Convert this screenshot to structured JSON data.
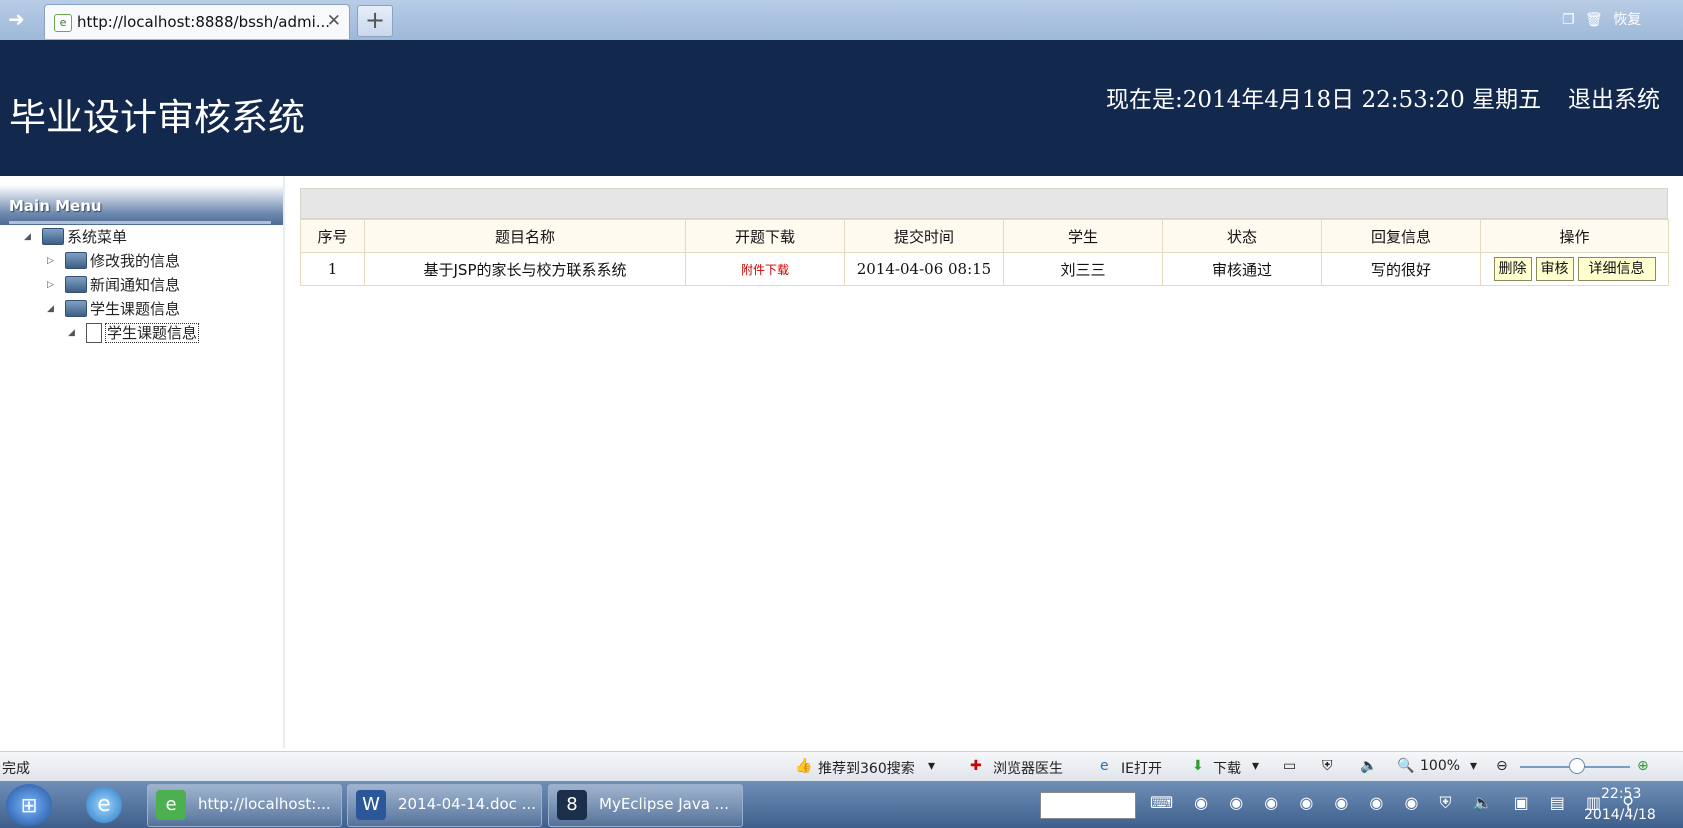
{
  "browser": {
    "tab_title": "http://localhost:8888/bssh/admi...",
    "tab_close": "✕",
    "new_tab": "+",
    "restore_label": "恢复"
  },
  "header": {
    "title": "毕业设计审核系统",
    "clock": "现在是:2014年4月18日  22:53:20 星期五",
    "logout": "退出系统"
  },
  "menu": {
    "heading": "Main Menu",
    "root": "系统菜单",
    "items": [
      "修改我的信息",
      "新闻通知信息",
      "学生课题信息"
    ],
    "sub_item": "学生课题信息"
  },
  "table": {
    "headers": [
      "序号",
      "题目名称",
      "开题下载",
      "提交时间",
      "学生",
      "状态",
      "回复信息",
      "操作"
    ],
    "rows": [
      {
        "no": "1",
        "topic": "基于JSP的家长与校方联系系统",
        "download": "附件下载",
        "time": "2014-04-06 08:15",
        "student": "刘三三",
        "status": "审核通过",
        "reply": "写的很好",
        "actions": [
          "删除",
          "审核",
          "详细信息"
        ]
      }
    ]
  },
  "statusbar": {
    "status": "完成",
    "recommend": "推荐到360搜索",
    "doctor": "浏览器医生",
    "ie_open": "IE打开",
    "download": "下载",
    "zoom": "100%"
  },
  "taskbar": {
    "windows": [
      "http://localhost:...",
      "2014-04-14.doc ...",
      "MyEclipse Java ..."
    ],
    "time": "22:53",
    "date": "2014/4/18"
  },
  "colors": {
    "header_bg": "#12284d",
    "download_link": "#cc0000",
    "action_button_bg": "#ffffd0"
  }
}
